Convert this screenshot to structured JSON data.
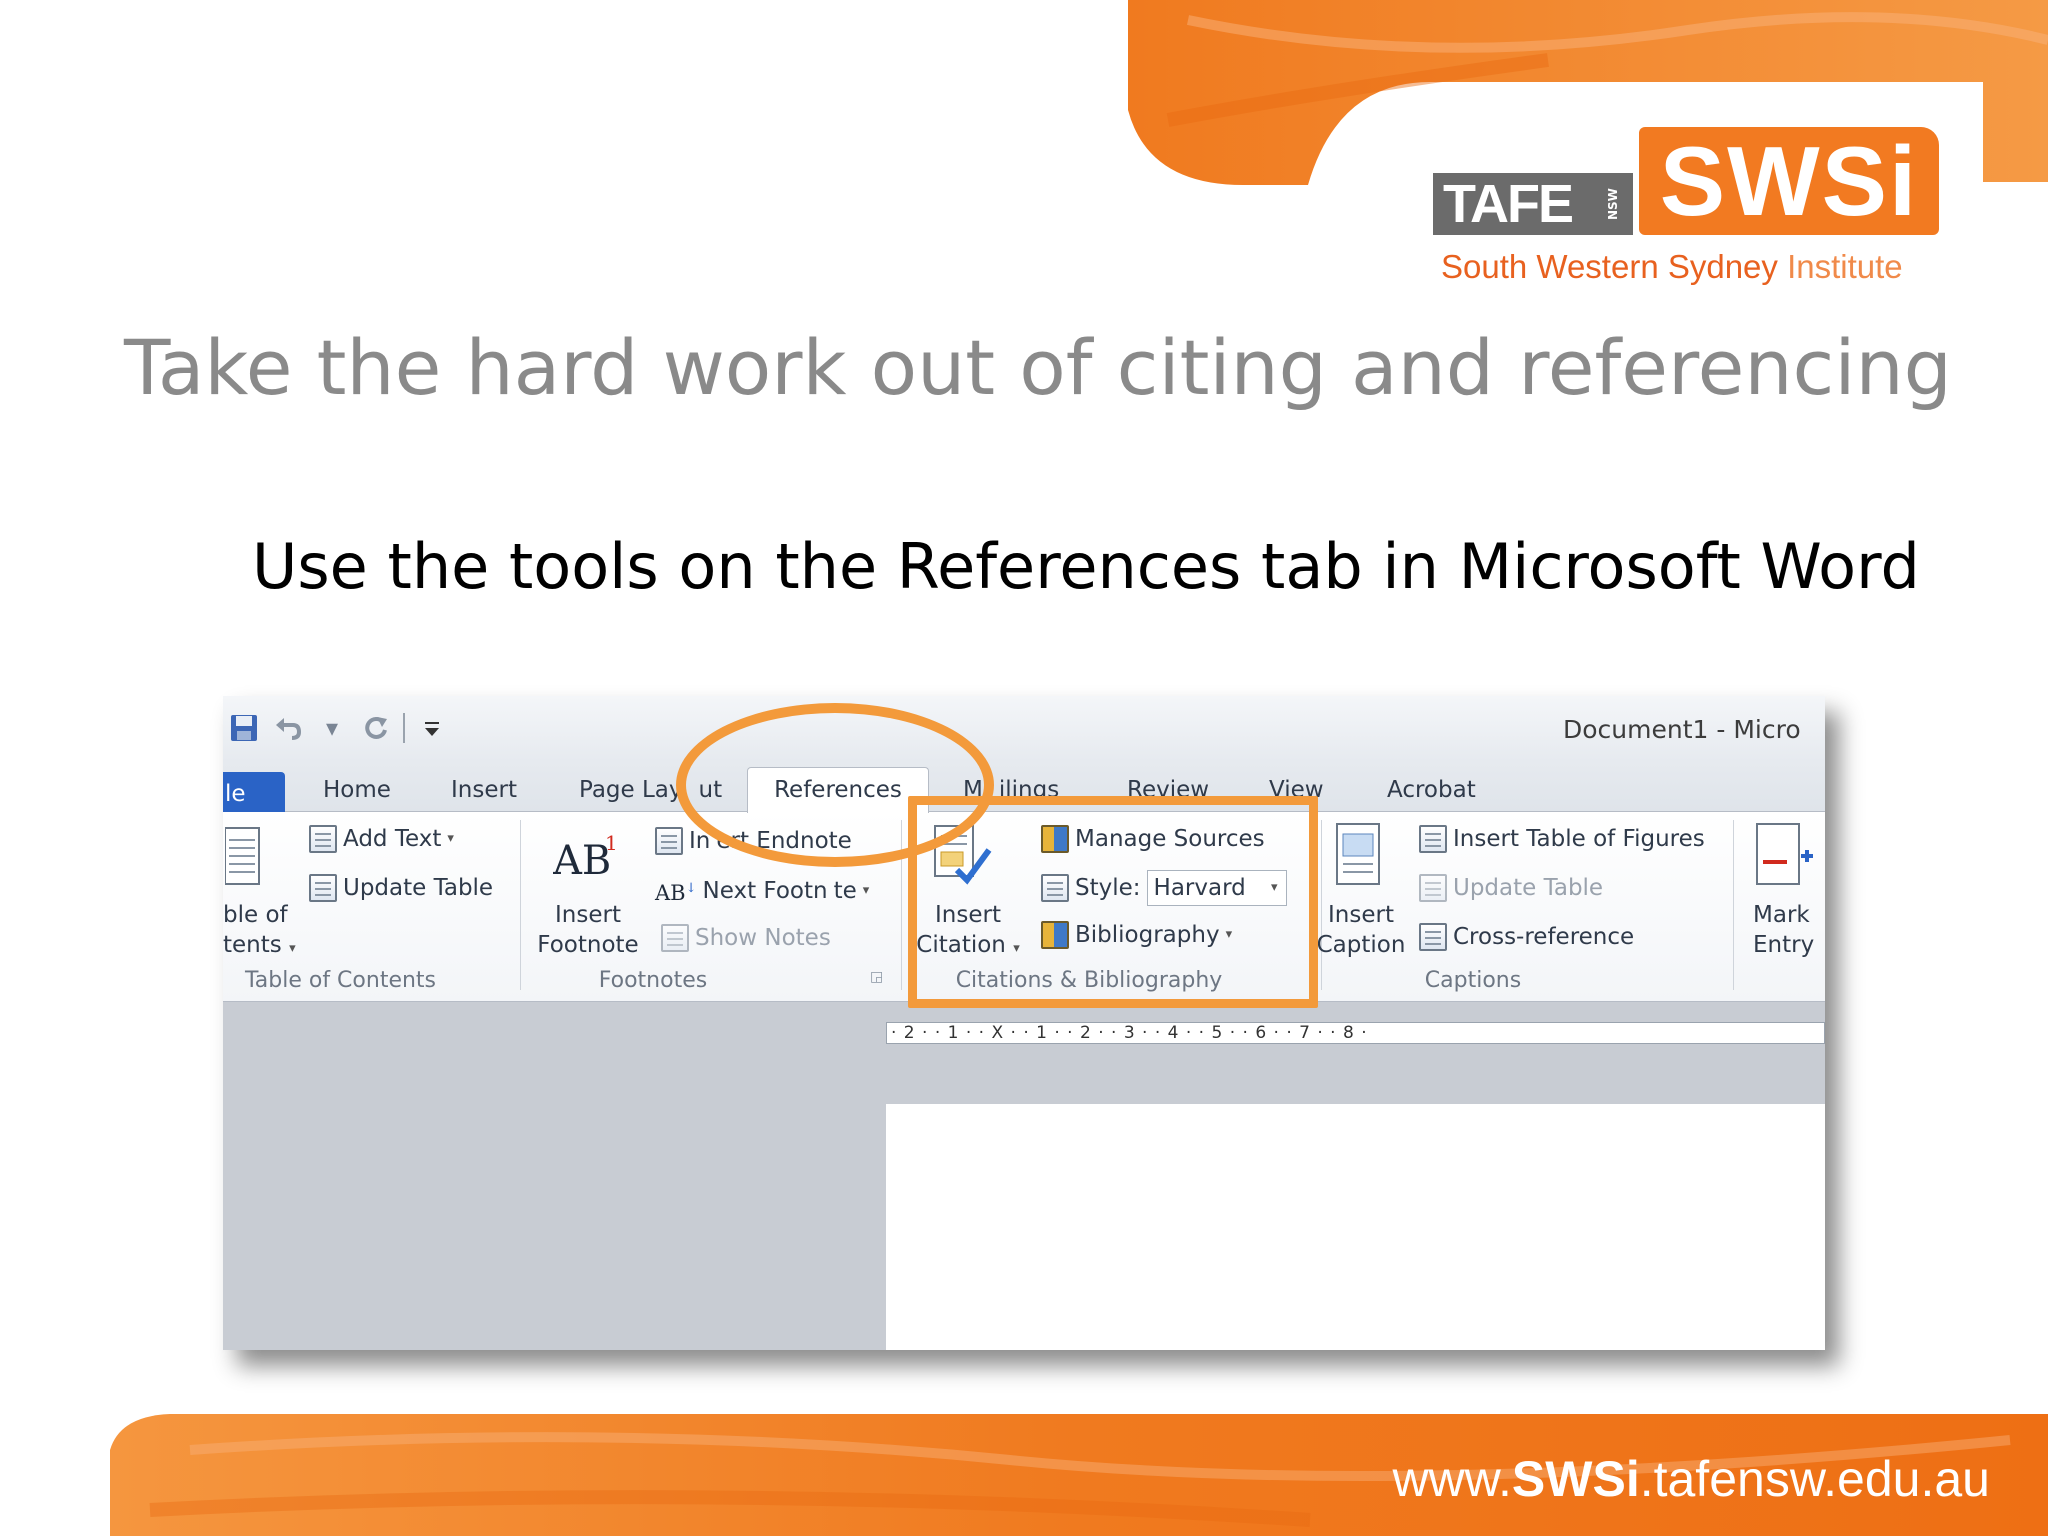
{
  "slide": {
    "title": "Take the hard work out of citing and referencing",
    "subtitle": "Use the tools on the References tab in Microsoft Word",
    "footer_prefix": "www.",
    "footer_brand": "SWSi",
    "footer_suffix": ".tafensw.edu.au",
    "colors": {
      "accent": "#f27a21",
      "title": "#8a8a8a",
      "highlight": "#f39a3b"
    }
  },
  "logo": {
    "tafe": "TAFE",
    "nsw": "NSW",
    "swsi": "SWSi",
    "subtitle_bold": "South Western Sydney",
    "subtitle_thin": " Institute"
  },
  "word": {
    "window_title": "Document1  -  Micro",
    "quick_access": [
      "save-icon",
      "undo-icon",
      "redo-icon",
      "customize-icon"
    ],
    "tabs": {
      "file": "le",
      "home": "Home",
      "insert": "Insert",
      "page_layout": "Page Lay",
      "page_layout_tail": "ut",
      "references": "References",
      "mailings_a": "M",
      "mailings_b": "ilings",
      "review": "Review",
      "view": "View",
      "acrobat": "Acrobat"
    },
    "toc": {
      "big_label_1": "ble of",
      "big_label_2": "tents",
      "add_text": "Add Text",
      "update_table": "Update Table",
      "group": "Table of Contents"
    },
    "footnotes": {
      "insert_footnote_1": "Insert",
      "insert_footnote_2": "Footnote",
      "insert_endnote_a": "In",
      "insert_endnote_b": "ert Endnote",
      "next_footnote_a": "Next Footn",
      "next_footnote_b": "te",
      "show_notes": "Show Notes",
      "group": "Footnotes"
    },
    "citations": {
      "insert_citation_1": "Insert",
      "insert_citation_2": "Citation",
      "manage_sources": "Manage Sources",
      "style_label": "Style:",
      "style_value": "Harvard",
      "bibliography": "Bibliography",
      "group": "Citations & Bibliography"
    },
    "captions": {
      "insert_caption_1": "Insert",
      "insert_caption_2": "Caption",
      "insert_table_of_figures": "Insert Table of Figures",
      "update_table": "Update Table",
      "cross_reference": "Cross-reference",
      "group": "Captions"
    },
    "index": {
      "mark_entry_1": "Mark",
      "mark_entry_2": "Entry"
    },
    "ruler": "· 2 · · 1 · · X · · 1 · · 2 · · 3 · · 4 · · 5 · · 6 · · 7 · · 8 ·"
  }
}
